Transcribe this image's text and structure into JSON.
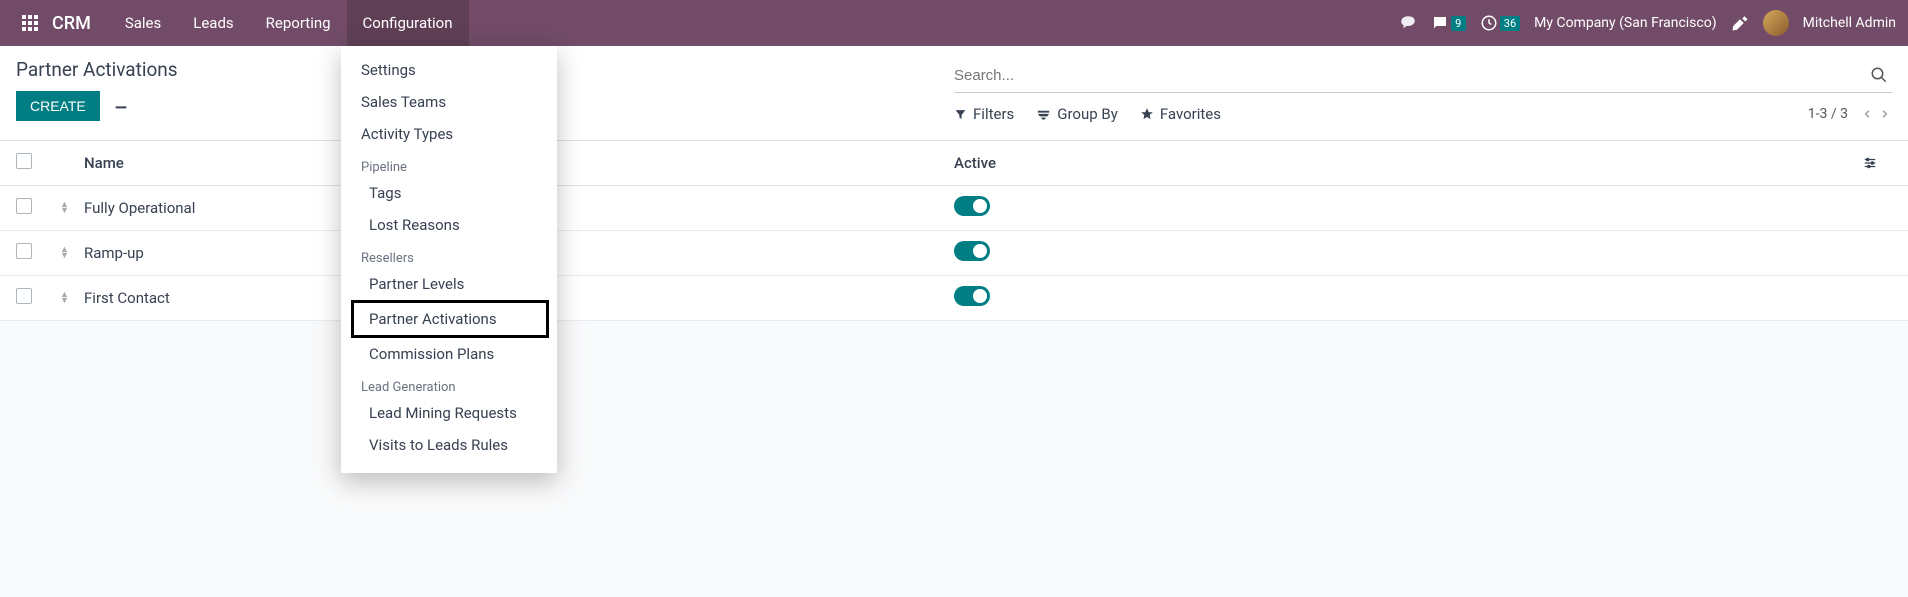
{
  "topbar": {
    "brand": "CRM",
    "nav": [
      "Sales",
      "Leads",
      "Reporting",
      "Configuration"
    ],
    "chat_badge": "9",
    "clock_badge": "36",
    "company": "My Company (San Francisco)",
    "user": "Mitchell Admin"
  },
  "dropdown": {
    "items_top": [
      "Settings",
      "Sales Teams",
      "Activity Types"
    ],
    "section_pipeline": "Pipeline",
    "items_pipeline": [
      "Tags",
      "Lost Reasons"
    ],
    "section_resellers": "Resellers",
    "items_resellers": [
      "Partner Levels",
      "Partner Activations",
      "Commission Plans"
    ],
    "section_leadgen": "Lead Generation",
    "items_leadgen": [
      "Lead Mining Requests",
      "Visits to Leads Rules"
    ]
  },
  "page": {
    "title": "Partner Activations",
    "create": "CREATE",
    "search_placeholder": "Search...",
    "filters": "Filters",
    "groupby": "Group By",
    "favorites": "Favorites",
    "pager": "1-3 / 3"
  },
  "table": {
    "col_name": "Name",
    "col_active": "Active",
    "rows": [
      {
        "name": "Fully Operational",
        "active": true
      },
      {
        "name": "Ramp-up",
        "active": true
      },
      {
        "name": "First Contact",
        "active": true
      }
    ]
  }
}
